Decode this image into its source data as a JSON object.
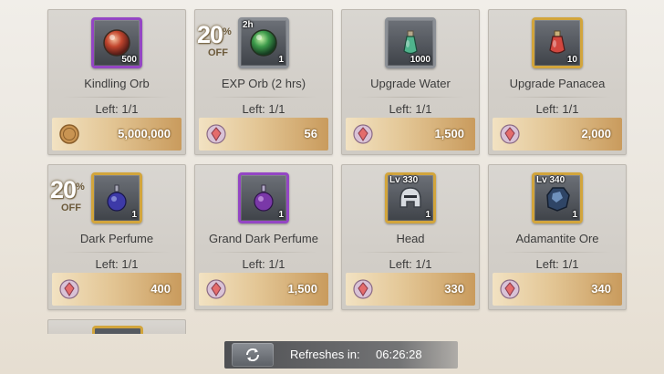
{
  "items": [
    {
      "name": "Kindling Orb",
      "left": "Left: 1/1",
      "price": "5,000,000",
      "currency": "gold-coin-icon",
      "qty": "500",
      "rarity": "purple",
      "icon": "kindling-orb-icon",
      "discount": "",
      "tag": ""
    },
    {
      "name": "EXP Orb (2 hrs)",
      "left": "Left: 1/1",
      "price": "56",
      "currency": "gem-currency-icon",
      "qty": "1",
      "rarity": "gray",
      "icon": "exp-orb-icon",
      "discount": "20",
      "tag": "2h"
    },
    {
      "name": "Upgrade Water",
      "left": "Left: 1/1",
      "price": "1,500",
      "currency": "gem-currency-icon",
      "qty": "1000",
      "rarity": "gray",
      "icon": "upgrade-water-icon",
      "discount": "",
      "tag": ""
    },
    {
      "name": "Upgrade Panacea",
      "left": "Left: 1/1",
      "price": "2,000",
      "currency": "gem-currency-icon",
      "qty": "10",
      "rarity": "gold",
      "icon": "upgrade-panacea-icon",
      "discount": "",
      "tag": ""
    },
    {
      "name": "Dark Perfume",
      "left": "Left: 1/1",
      "price": "400",
      "currency": "gem-currency-icon",
      "qty": "1",
      "rarity": "gold",
      "icon": "dark-perfume-icon",
      "discount": "20",
      "tag": ""
    },
    {
      "name": "Grand Dark Perfume",
      "left": "Left: 1/1",
      "price": "1,500",
      "currency": "gem-currency-icon",
      "qty": "1",
      "rarity": "purple",
      "icon": "grand-dark-perfume-icon",
      "discount": "",
      "tag": ""
    },
    {
      "name": "Head",
      "left": "Left: 1/1",
      "price": "330",
      "currency": "gem-currency-icon",
      "qty": "1",
      "rarity": "gold",
      "icon": "helmet-icon",
      "discount": "",
      "tag": "Lv 330"
    },
    {
      "name": "Adamantite Ore",
      "left": "Left: 1/1",
      "price": "340",
      "currency": "gem-currency-icon",
      "qty": "1",
      "rarity": "gold",
      "icon": "adamantite-ore-icon",
      "discount": "",
      "tag": "Lv 340"
    }
  ],
  "discount_symbol": "%",
  "discount_off": "OFF",
  "refresh": {
    "label": "Refreshes in:",
    "time": "06:26:28"
  },
  "colors": {
    "gray": "#8c9096",
    "gold": "#d2a53c",
    "purple": "#9446c4"
  }
}
